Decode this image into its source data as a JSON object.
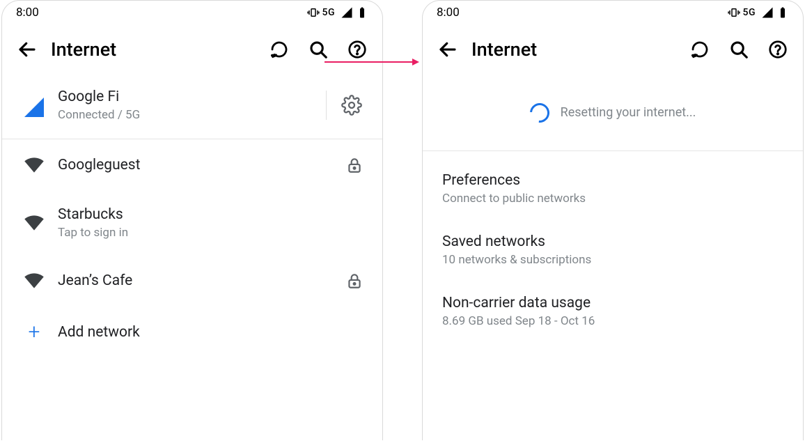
{
  "status": {
    "time": "8:00",
    "network_label": "5G"
  },
  "appbar": {
    "title": "Internet"
  },
  "left": {
    "carrier": {
      "name": "Google Fi",
      "status": "Connected / 5G"
    },
    "wifi": [
      {
        "ssid": "Googleguest",
        "secure": true
      },
      {
        "ssid": "Starbucks",
        "subtitle": "Tap to sign in",
        "secure": false
      },
      {
        "ssid": "Jean’s Cafe",
        "secure": true
      }
    ],
    "add_network": "Add network"
  },
  "right": {
    "reset_label": "Resetting your internet...",
    "prefs": [
      {
        "title": "Preferences",
        "subtitle": "Connect to public networks"
      },
      {
        "title": "Saved networks",
        "subtitle": "10 networks & subscriptions"
      },
      {
        "title": "Non-carrier data usage",
        "subtitle": "8.69 GB used Sep 18 - Oct 16"
      }
    ]
  }
}
